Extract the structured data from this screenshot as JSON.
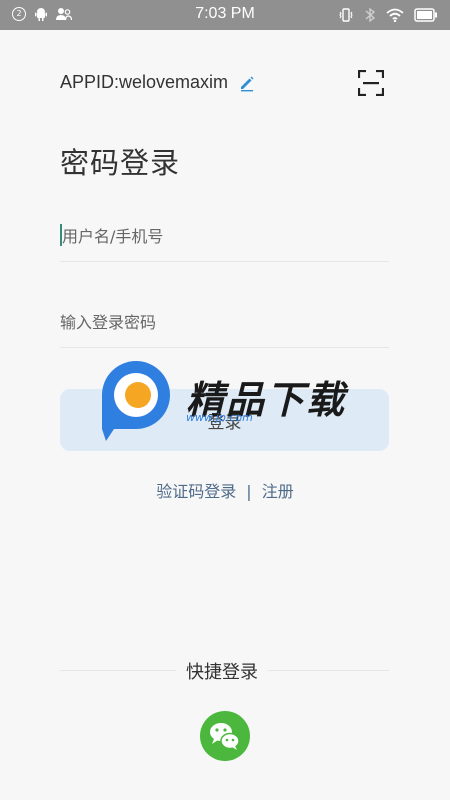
{
  "status_bar": {
    "notification_count": "2",
    "time": "7:03 PM"
  },
  "header": {
    "appid": "APPID:welovemaxim"
  },
  "login": {
    "title": "密码登录",
    "username_placeholder": "用户名/手机号",
    "password_placeholder": "输入登录密码",
    "login_button": "登录"
  },
  "links": {
    "sms_login": "验证码登录",
    "divider": "|",
    "register": "注册"
  },
  "quick_login": {
    "label": "快捷登录"
  },
  "watermark": {
    "title": "精品下载",
    "url": "www.jp.com"
  },
  "colors": {
    "status_bar": "#909090",
    "background": "#f7f7f7",
    "login_button_bg": "#dfeaf7",
    "link": "#4f6b8a",
    "edit_icon": "#2f8fd6",
    "wechat": "#4bb83d"
  }
}
